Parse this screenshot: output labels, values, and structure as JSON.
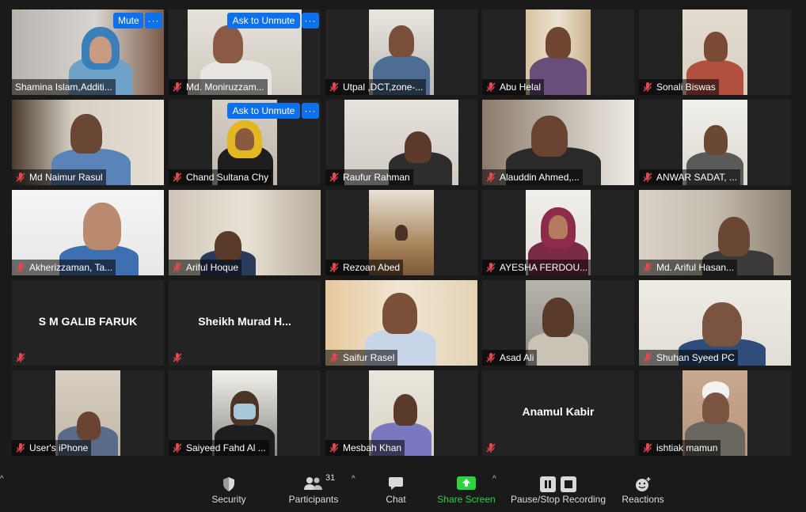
{
  "tiles": [
    {
      "name": "Shamina Islam,Additi...",
      "mic_off": false,
      "hover": "Mute"
    },
    {
      "name": "Md. Moniruzzam...",
      "mic_off": true,
      "hover": "Ask to Unmute"
    },
    {
      "name": "Utpal ,DCT,zone-...",
      "mic_off": true
    },
    {
      "name": "Abu Helal",
      "mic_off": true
    },
    {
      "name": "Sonali Biswas",
      "mic_off": true
    },
    {
      "name": "Md Naimur Rasul",
      "mic_off": true
    },
    {
      "name": "Chand Sultana Chy",
      "mic_off": true,
      "hover": "Ask to Unmute"
    },
    {
      "name": "Raufur Rahman",
      "mic_off": true
    },
    {
      "name": "Alauddin Ahmed,...",
      "mic_off": true
    },
    {
      "name": "ANWAR SADAT, ...",
      "mic_off": true
    },
    {
      "name": "Akherizzaman, Ta...",
      "mic_off": true
    },
    {
      "name": "Ariful Hoque",
      "mic_off": true
    },
    {
      "name": "Rezoan Abed",
      "mic_off": true
    },
    {
      "name": "AYESHA FERDOU...",
      "mic_off": true
    },
    {
      "name": "Md. Ariful Hasan...",
      "mic_off": true
    },
    {
      "name": "",
      "display_name": "S M GALIB FARUK",
      "mic_off": true
    },
    {
      "name": "",
      "display_name": "Sheikh  Murad  H...",
      "mic_off": true
    },
    {
      "name": "Saifur Rasel",
      "mic_off": true
    },
    {
      "name": "Asad Ali",
      "mic_off": true
    },
    {
      "name": "Shuhan Syeed PC",
      "mic_off": true
    },
    {
      "name": "User's iPhone",
      "mic_off": true
    },
    {
      "name": "Saiyeed Fahd Al ...",
      "mic_off": true
    },
    {
      "name": "Mesbah Khan",
      "mic_off": true
    },
    {
      "name": "",
      "display_name": "Anamul Kabir",
      "mic_off": true
    },
    {
      "name": "ishtiak mamun",
      "mic_off": true
    }
  ],
  "toolbar": {
    "security": "Security",
    "participants": "Participants",
    "participants_count": "31",
    "chat": "Chat",
    "share_screen": "Share Screen",
    "recording": "Pause/Stop Recording",
    "reactions": "Reactions"
  },
  "colors": {
    "share_green": "#2ad33f",
    "hover_blue": "#0e71eb",
    "mic_red": "#e0494e"
  }
}
